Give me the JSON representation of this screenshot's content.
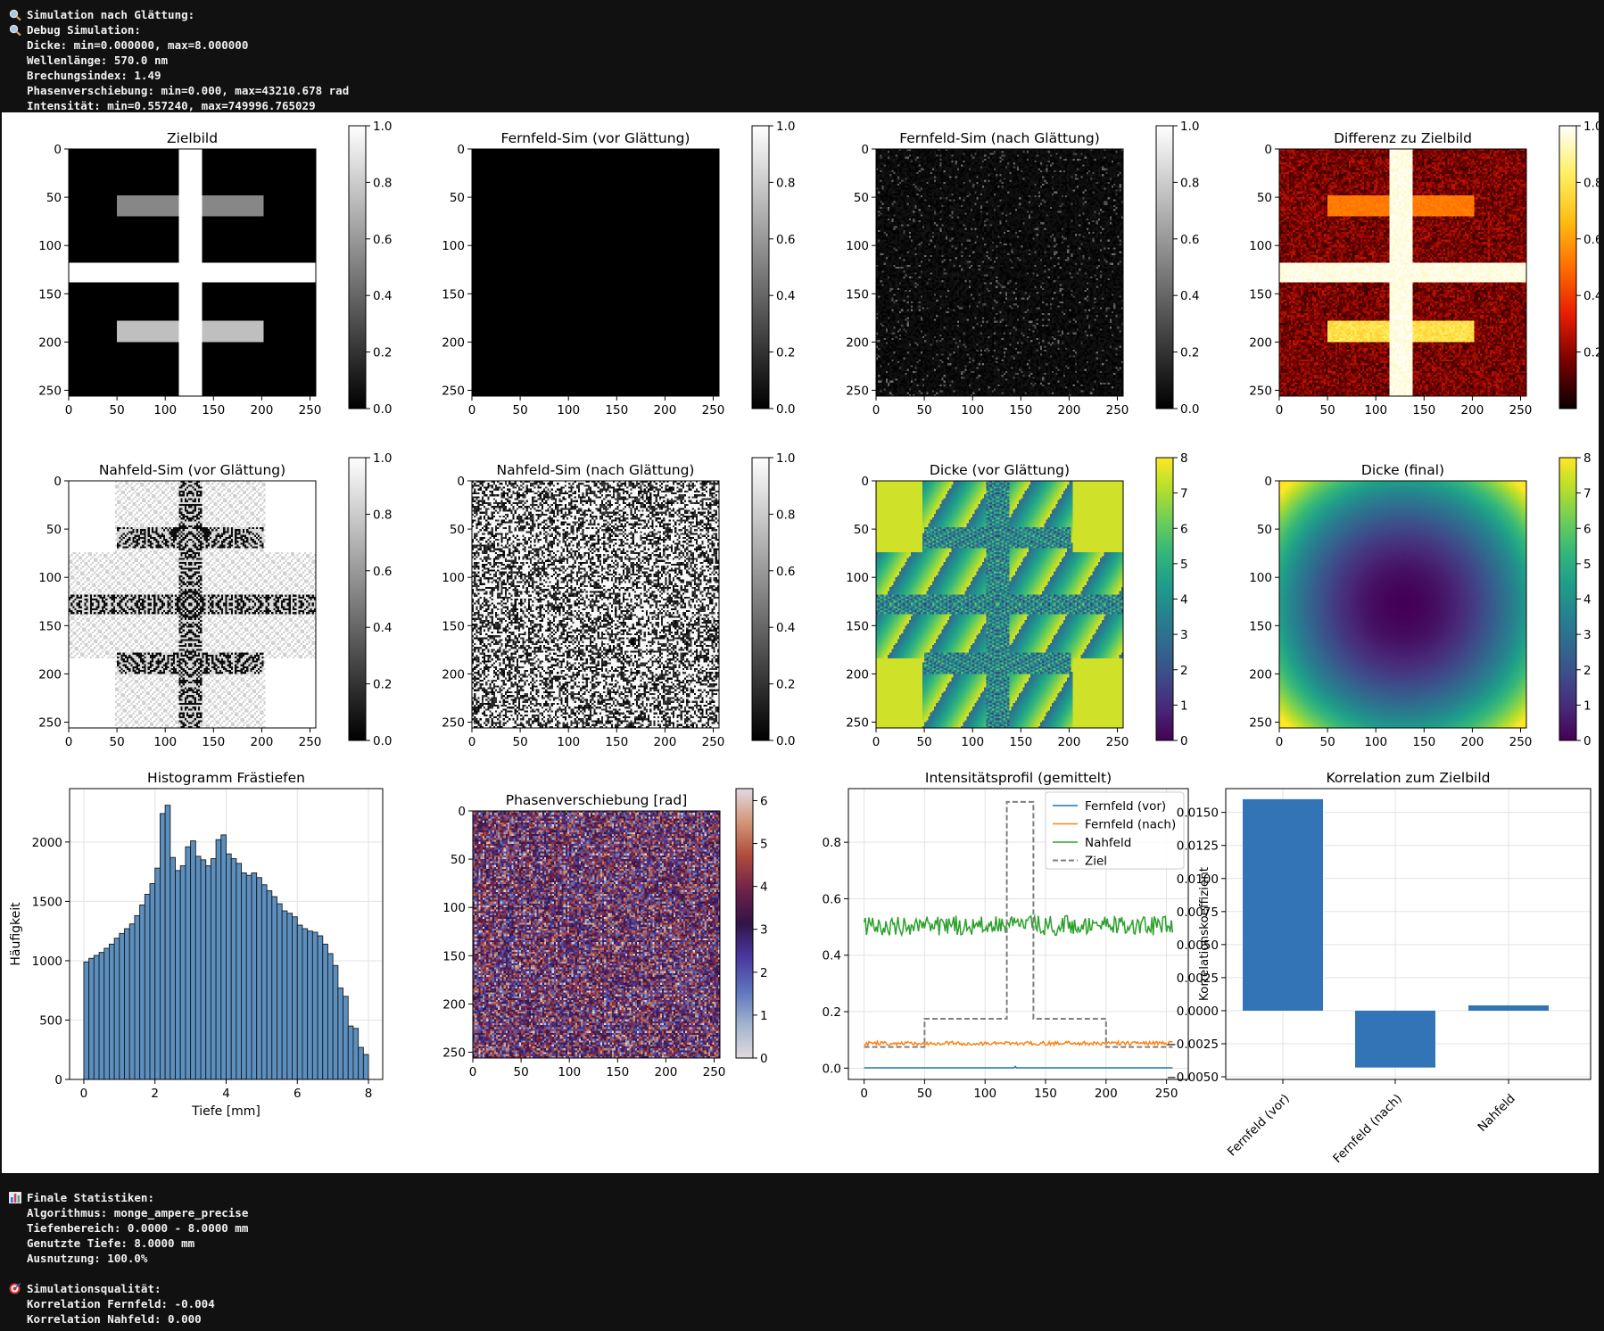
{
  "console_top": {
    "lines": [
      {
        "icon": "magnifier-icon",
        "text": "Simulation nach Glättung:"
      },
      {
        "icon": "magnifier-icon",
        "text": "Debug Simulation:"
      },
      {
        "icon": "",
        "text": "Dicke: min=0.000000, max=8.000000"
      },
      {
        "icon": "",
        "text": "Wellenlänge: 570.0 nm"
      },
      {
        "icon": "",
        "text": "Brechungsindex: 1.49"
      },
      {
        "icon": "",
        "text": "Phasenverschiebung: min=0.000, max=43210.678 rad"
      },
      {
        "icon": "",
        "text": "Intensität: min=0.557240, max=749996.765029"
      }
    ]
  },
  "console_bottom": {
    "lines": [
      {
        "icon": "bar-chart-icon",
        "text": "Finale Statistiken:"
      },
      {
        "icon": "",
        "text": "Algorithmus: monge_ampere_precise"
      },
      {
        "icon": "",
        "text": "Tiefenbereich: 0.0000 - 8.0000 mm"
      },
      {
        "icon": "",
        "text": "Genutzte Tiefe: 8.0000 mm"
      },
      {
        "icon": "",
        "text": "Ausnutzung: 100.0%"
      },
      {
        "icon": "",
        "text": ""
      },
      {
        "icon": "target-icon",
        "text": "Simulationsqualität:"
      },
      {
        "icon": "",
        "text": "Korrelation Fernfeld: -0.004"
      },
      {
        "icon": "",
        "text": "Korrelation Nahfeld: 0.000"
      }
    ]
  },
  "chart_data": [
    {
      "type": "heatmap",
      "title": "Zielbild",
      "render": "target",
      "colormap": "gray",
      "image_size": 256,
      "xticks": [
        0,
        50,
        100,
        150,
        200,
        250
      ],
      "yticks": [
        0,
        50,
        100,
        150,
        200,
        250
      ],
      "colorbar": {
        "ticks": [
          "0.0",
          "0.2",
          "0.4",
          "0.6",
          "0.8",
          "1.0"
        ],
        "range": [
          0,
          1
        ]
      }
    },
    {
      "type": "heatmap",
      "title": "Fernfeld-Sim (vor Glättung)",
      "render": "black_dot",
      "colormap": "gray",
      "image_size": 256,
      "xticks": [
        0,
        50,
        100,
        150,
        200,
        250
      ],
      "yticks": [
        0,
        50,
        100,
        150,
        200,
        250
      ],
      "colorbar": {
        "ticks": [
          "0.0",
          "0.2",
          "0.4",
          "0.6",
          "0.8",
          "1.0"
        ],
        "range": [
          0,
          1
        ]
      }
    },
    {
      "type": "heatmap",
      "title": "Fernfeld-Sim (nach Glättung)",
      "render": "dark_noise",
      "colormap": "gray",
      "image_size": 256,
      "xticks": [
        0,
        50,
        100,
        150,
        200,
        250
      ],
      "yticks": [
        0,
        50,
        100,
        150,
        200,
        250
      ],
      "colorbar": {
        "ticks": [
          "0.0",
          "0.2",
          "0.4",
          "0.6",
          "0.8",
          "1.0"
        ],
        "range": [
          0,
          1
        ]
      }
    },
    {
      "type": "heatmap",
      "title": "Differenz zu Zielbild",
      "render": "diff",
      "colormap": "hot",
      "image_size": 256,
      "xticks": [
        0,
        50,
        100,
        150,
        200,
        250
      ],
      "yticks": [
        0,
        50,
        100,
        150,
        200,
        250
      ],
      "colorbar": {
        "ticks": [
          "0.2",
          "0.4",
          "0.6",
          "0.8",
          "1.0"
        ],
        "range": [
          0,
          1
        ]
      }
    },
    {
      "type": "heatmap",
      "title": "Nahfeld-Sim (vor Glättung)",
      "render": "nahfeld",
      "colormap": "gray",
      "image_size": 256,
      "xticks": [
        0,
        50,
        100,
        150,
        200,
        250
      ],
      "yticks": [
        0,
        50,
        100,
        150,
        200,
        250
      ],
      "colorbar": {
        "ticks": [
          "0.0",
          "0.2",
          "0.4",
          "0.6",
          "0.8",
          "1.0"
        ],
        "range": [
          0,
          1
        ]
      }
    },
    {
      "type": "heatmap",
      "title": "Nahfeld-Sim (nach Glättung)",
      "render": "bw_noise",
      "colormap": "gray",
      "image_size": 256,
      "xticks": [
        0,
        50,
        100,
        150,
        200,
        250
      ],
      "yticks": [
        0,
        50,
        100,
        150,
        200,
        250
      ],
      "colorbar": {
        "ticks": [
          "0.0",
          "0.2",
          "0.4",
          "0.6",
          "0.8",
          "1.0"
        ],
        "range": [
          0,
          1
        ]
      }
    },
    {
      "type": "heatmap",
      "title": "Dicke (vor Glättung)",
      "render": "dicke_vor",
      "colormap": "viridis",
      "image_size": 256,
      "xticks": [
        0,
        50,
        100,
        150,
        200,
        250
      ],
      "yticks": [
        0,
        50,
        100,
        150,
        200,
        250
      ],
      "colorbar": {
        "ticks": [
          "0",
          "1",
          "2",
          "3",
          "4",
          "5",
          "6",
          "7",
          "8"
        ],
        "range": [
          0,
          8
        ]
      }
    },
    {
      "type": "heatmap",
      "title": "Dicke (final)",
      "render": "bowl",
      "colormap": "viridis",
      "image_size": 256,
      "xticks": [
        0,
        50,
        100,
        150,
        200,
        250
      ],
      "yticks": [
        0,
        50,
        100,
        150,
        200,
        250
      ],
      "colorbar": {
        "ticks": [
          "0",
          "1",
          "2",
          "3",
          "4",
          "5",
          "6",
          "7",
          "8"
        ],
        "range": [
          0,
          8
        ]
      }
    },
    {
      "type": "bar",
      "title": "Histogramm Frästiefen",
      "xlabel": "Tiefe [mm]",
      "ylabel": "Häufigkeit",
      "xlim": [
        -0.4,
        8.4
      ],
      "ylim": [
        0,
        2450
      ],
      "xticks": [
        "0",
        "2",
        "4",
        "6",
        "8"
      ],
      "yticks": [
        "0",
        "500",
        "1000",
        "1500",
        "2000"
      ],
      "bin_edges": [
        0,
        8
      ],
      "values": [
        990,
        1020,
        1045,
        1070,
        1105,
        1140,
        1190,
        1230,
        1270,
        1310,
        1380,
        1470,
        1560,
        1650,
        1780,
        2240,
        2310,
        1870,
        1760,
        1800,
        1960,
        2010,
        1880,
        1850,
        1800,
        1860,
        2020,
        2060,
        1900,
        1860,
        1820,
        1740,
        1720,
        1740,
        1700,
        1640,
        1590,
        1540,
        1480,
        1420,
        1400,
        1370,
        1300,
        1270,
        1250,
        1240,
        1210,
        1140,
        1060,
        960,
        770,
        700,
        450,
        430,
        270,
        210
      ]
    },
    {
      "type": "heatmap",
      "title": "Phasenverschiebung [rad]",
      "render": "phase",
      "colormap": "twilight",
      "image_size": 256,
      "xticks": [
        0,
        50,
        100,
        150,
        200,
        250
      ],
      "yticks": [
        0,
        50,
        100,
        150,
        200,
        250
      ],
      "colorbar": {
        "ticks": [
          "0",
          "1",
          "2",
          "3",
          "4",
          "5",
          "6"
        ],
        "range": [
          0,
          6.28
        ]
      }
    },
    {
      "type": "line",
      "title": "Intensitätsprofil (gemittelt)",
      "xlim": [
        -13,
        268
      ],
      "ylim": [
        -0.04,
        0.99
      ],
      "xticks": [
        "0",
        "50",
        "100",
        "150",
        "200",
        "250"
      ],
      "yticks": [
        "0.0",
        "0.2",
        "0.4",
        "0.6",
        "0.8"
      ],
      "legend_position": "upper right",
      "series": [
        {
          "name": "Fernfeld (vor)",
          "color": "#1f77b4",
          "style": "fernvor",
          "base": 0.001
        },
        {
          "name": "Fernfeld (nach)",
          "color": "#ff7f0e",
          "style": "noise",
          "base": 0.088,
          "amp": 0.007
        },
        {
          "name": "Nahfeld",
          "color": "#2ca02c",
          "style": "noise",
          "base": 0.505,
          "amp": 0.035
        },
        {
          "name": "Ziel",
          "color": "#7f7f7f",
          "style": "dashed",
          "points": [
            [
              0,
              0.075
            ],
            [
              50,
              0.075
            ],
            [
              50,
              0.175
            ],
            [
              118,
              0.175
            ],
            [
              118,
              0.943
            ],
            [
              140,
              0.943
            ],
            [
              140,
              0.175
            ],
            [
              200,
              0.175
            ],
            [
              200,
              0.075
            ],
            [
              255,
              0.075
            ]
          ]
        }
      ]
    },
    {
      "type": "bar",
      "title": "Korrelation zum Zielbild",
      "ylabel": "Korrelationskoeffizient",
      "categories": [
        "Fernfeld (vor)",
        "Fernfeld (nach)",
        "Nahfeld"
      ],
      "values": [
        0.016,
        -0.0043,
        0.0004
      ],
      "ylim": [
        -0.0052,
        0.0168
      ],
      "yticks": [
        "-0.0050",
        "-0.0025",
        "0.0000",
        "0.0025",
        "0.0050",
        "0.0075",
        "0.0100",
        "0.0125",
        "0.0150"
      ],
      "color": "#3274b5"
    }
  ]
}
